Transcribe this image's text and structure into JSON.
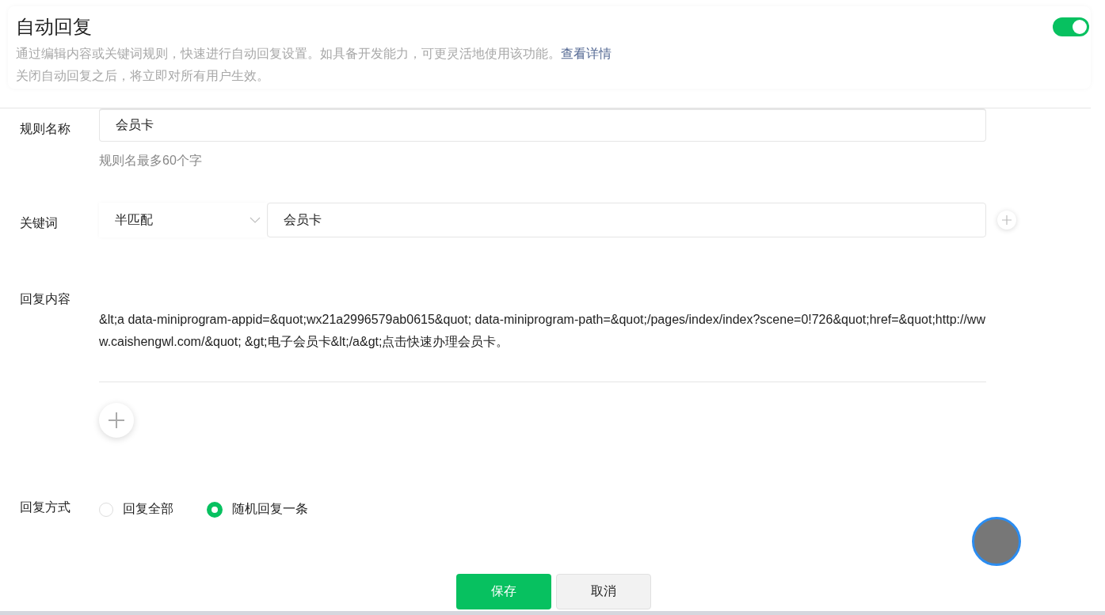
{
  "header": {
    "title": "自动回复",
    "enabled": true,
    "description": "通过编辑内容或关键词规则，快速进行自动回复设置。如具备开发能力，可更灵活地使用该功能。",
    "details_link": "查看详情",
    "note": "关闭自动回复之后，将立即对所有用户生效。"
  },
  "rule_name": {
    "label": "规则名称",
    "value": "会员卡",
    "hint": "规则名最多60个字"
  },
  "keyword": {
    "label": "关键词",
    "match_mode": "半匹配",
    "value": "会员卡"
  },
  "reply_content": {
    "label": "回复内容",
    "text": "&lt;a data-miniprogram-appid=&quot;wx21a2996579ab0615&quot; data-miniprogram-path=&quot;/pages/index/index?scene=0!726&quot;href=&quot;http://www.caishengwl.com/&quot; &gt;电子会员卡&lt;/a&gt;点击快速办理会员卡。"
  },
  "reply_mode": {
    "label": "回复方式",
    "options": [
      {
        "label": "回复全部",
        "selected": false
      },
      {
        "label": "随机回复一条",
        "selected": true
      }
    ]
  },
  "buttons": [
    {
      "label": "保存",
      "kind": "primary"
    },
    {
      "label": "取消",
      "kind": "default"
    }
  ]
}
